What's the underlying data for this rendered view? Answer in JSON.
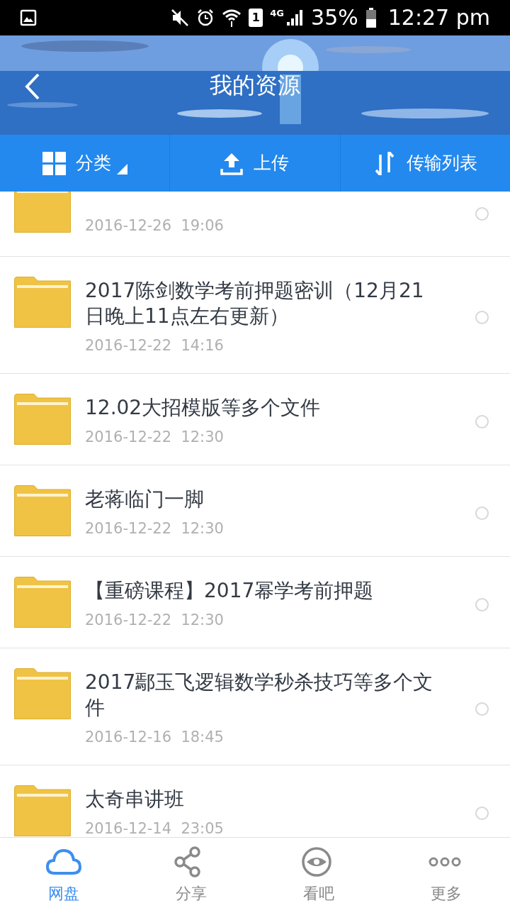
{
  "status_bar": {
    "sim": "1",
    "network": "4G",
    "battery": "35%",
    "time": "12:27 pm"
  },
  "header": {
    "title": "我的资源"
  },
  "toolbar": [
    {
      "kind": "category",
      "label": "分类"
    },
    {
      "kind": "upload",
      "label": "上传"
    },
    {
      "kind": "transfer",
      "label": "传输列表"
    }
  ],
  "files": [
    {
      "date": "2016-12-26  19:06",
      "selected": false
    },
    {
      "name": "2017陈剑数学考前押题密训（12月21日晚上11点左右更新）",
      "date": "2016-12-22  14:16",
      "selected": false
    },
    {
      "name": "12.02大招模版等多个文件",
      "date": "2016-12-22  12:30",
      "selected": false
    },
    {
      "name": "老蒋临门一脚",
      "date": "2016-12-22  12:30",
      "selected": false
    },
    {
      "name": "【重磅课程】2017幂学考前押题",
      "date": "2016-12-22  12:30",
      "selected": false
    },
    {
      "name": "2017鄢玉飞逻辑数学秒杀技巧等多个文件",
      "date": "2016-12-16  18:45",
      "selected": false
    },
    {
      "name": "太奇串讲班",
      "date": "2016-12-14  23:05",
      "selected": false
    }
  ],
  "tabs": [
    {
      "kind": "cloud",
      "label": "网盘",
      "selected": true
    },
    {
      "kind": "share",
      "label": "分享",
      "selected": false
    },
    {
      "kind": "eye",
      "label": "看吧",
      "selected": false
    },
    {
      "kind": "more",
      "label": "更多",
      "selected": false
    }
  ]
}
